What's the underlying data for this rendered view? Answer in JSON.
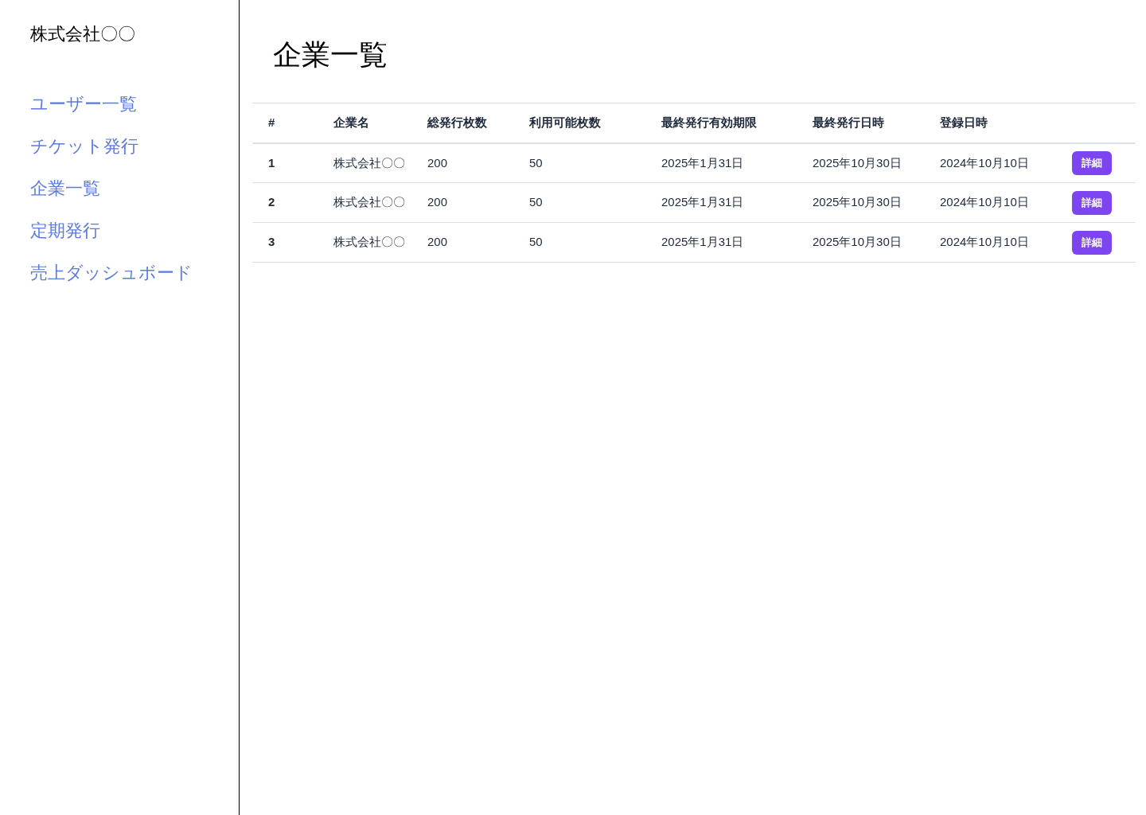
{
  "sidebar": {
    "company": "株式会社〇〇",
    "items": [
      {
        "label": "ユーザー一覧"
      },
      {
        "label": "チケット発行"
      },
      {
        "label": "企業一覧"
      },
      {
        "label": "定期発行"
      },
      {
        "label": "売上ダッシュボード"
      }
    ]
  },
  "page_title": "企業一覧",
  "table": {
    "columns": [
      "#",
      "企業名",
      "総発行枚数",
      "利用可能枚数",
      "最終発行有効期限",
      "最終発行日時",
      "登録日時"
    ],
    "rows": [
      {
        "cells": [
          "1",
          "株式会社〇〇",
          "200",
          "50",
          "2025年1月31日",
          "2025年10月30日",
          "2024年10月10日"
        ],
        "button": "詳細"
      },
      {
        "cells": [
          "2",
          "株式会社〇〇",
          "200",
          "50",
          "2025年1月31日",
          "2025年10月30日",
          "2024年10月10日"
        ],
        "button": "詳細"
      },
      {
        "cells": [
          "3",
          "株式会社〇〇",
          "200",
          "50",
          "2025年1月31日",
          "2025年10月30日",
          "2024年10月10日"
        ],
        "button": "詳細"
      }
    ]
  }
}
